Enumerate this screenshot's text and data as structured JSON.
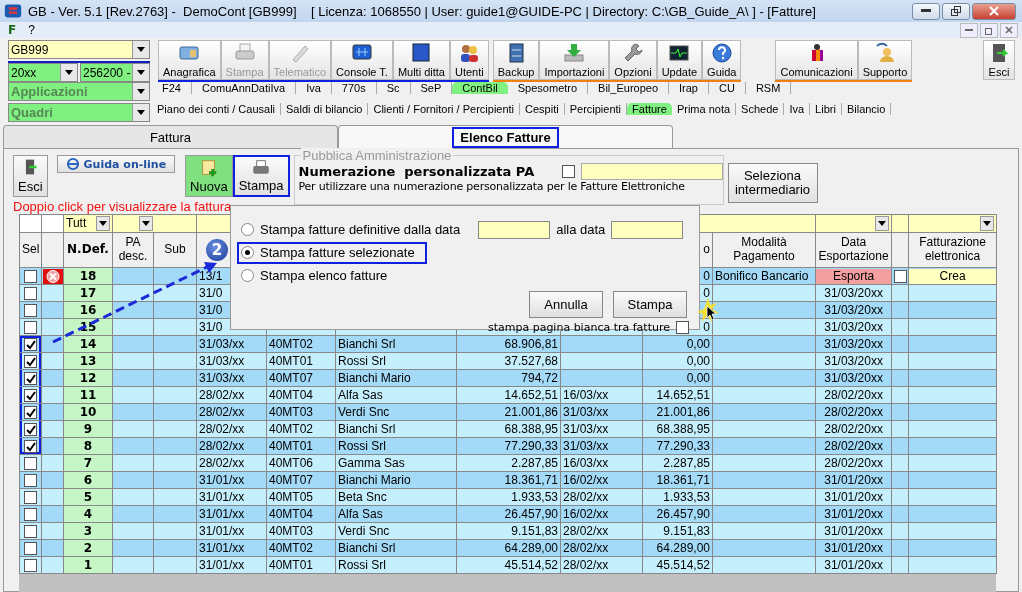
{
  "window": {
    "title": "GB - Ver. 5.1 [Rev.2763] -  DemoCont [GB999]    [ Licenza: 1068550 | User: guide1@GUIDE-PC | Directory: C:\\GB_Guide_A\\ ] - [Fatture]"
  },
  "menu": [
    "F",
    "?"
  ],
  "selectors": {
    "company": "GB999",
    "year": "20xx",
    "account": "256200 -",
    "applications": "Applicazioni",
    "panels": "Quadri"
  },
  "toolbar": [
    {
      "color": "#1020e0",
      "items": [
        {
          "label": "Anagrafica",
          "disabled": false
        },
        {
          "label": "Stampa",
          "disabled": true
        },
        {
          "label": "Telematico",
          "disabled": true
        },
        {
          "label": "Console T.",
          "disabled": false
        },
        {
          "label": "Multi ditta",
          "disabled": false
        },
        {
          "label": "Utenti",
          "disabled": false
        }
      ]
    },
    {
      "color": "#f08010",
      "items": [
        {
          "label": "Backup",
          "disabled": false
        },
        {
          "label": "Importazioni",
          "disabled": false
        },
        {
          "label": "Opzioni",
          "disabled": false
        },
        {
          "label": "Update",
          "disabled": false
        },
        {
          "label": "Guida",
          "disabled": false
        }
      ]
    },
    {
      "color": "#f08010",
      "items": [
        {
          "label": "Comunicazioni",
          "disabled": false
        },
        {
          "label": "Supporto",
          "disabled": false
        }
      ]
    },
    {
      "items": [
        {
          "label": "Esci",
          "disabled": false
        }
      ]
    }
  ],
  "app_tabs": [
    {
      "label": "F24",
      "selected": false
    },
    {
      "label": "ComuAnnDatiIva",
      "selected": false
    },
    {
      "label": "Iva",
      "selected": false
    },
    {
      "label": "770s",
      "selected": false
    },
    {
      "label": "Sc",
      "selected": false
    },
    {
      "label": "SeP",
      "selected": false
    },
    {
      "label": "ContBil",
      "selected": true
    },
    {
      "label": "Spesometro",
      "selected": false
    },
    {
      "label": "Bil_Europeo",
      "selected": false
    },
    {
      "label": "Irap",
      "selected": false
    },
    {
      "label": "CU",
      "selected": false
    },
    {
      "label": "RSM",
      "selected": false
    }
  ],
  "section_tabs": [
    {
      "label": "Piano dei conti / Causali",
      "selected": false
    },
    {
      "label": "Saldi di bilancio",
      "selected": false
    },
    {
      "label": "Clienti / Fornitori / Percipienti",
      "selected": false
    },
    {
      "label": "Cespiti",
      "selected": false
    },
    {
      "label": "Percipienti",
      "selected": false
    },
    {
      "label": "Fatture",
      "selected": true
    },
    {
      "label": "Prima nota",
      "selected": false
    },
    {
      "label": "Schede",
      "selected": false
    },
    {
      "label": "Iva",
      "selected": false
    },
    {
      "label": "Libri",
      "selected": false
    },
    {
      "label": "Bilancio",
      "selected": false
    }
  ],
  "view_tabs": [
    {
      "label": "Fattura",
      "selected": false,
      "highlighted": false
    },
    {
      "label": "Elenco Fatture",
      "selected": true,
      "highlighted": true
    }
  ],
  "actions": [
    {
      "kind": "exit",
      "label": "Esci",
      "highlighted": false
    },
    {
      "kind": "help",
      "label": "Guida on-line",
      "highlighted": false
    },
    {
      "kind": "new",
      "label": "Nuova",
      "highlighted": false
    },
    {
      "kind": "print",
      "label": "Stampa",
      "highlighted": true
    }
  ],
  "pa_group": {
    "legend": "Pubblica Amministrazione",
    "title": "Numerazione  personalizzata PA",
    "checked": false,
    "hint": "Per utilizzare una numerazione personalizzata per le Fatture Elettroniche",
    "button": "Seleziona intermediario"
  },
  "notice": "Doppio click per visualizzare la fattura",
  "table": {
    "filter": "Tutt",
    "headers": {
      "sel": "Sel",
      "number": "N.Def.",
      "pa_desc": "PA desc.",
      "sub": "Sub",
      "column_11": "o",
      "payment": "Modalità Pagamento",
      "export_date": "Data Esportazione",
      "e_invoicing": "Fatturazione elettronica"
    },
    "rows": [
      {
        "checked": false,
        "highlighted": false,
        "invalid": true,
        "number": "18",
        "date": "13/1",
        "amount2": "0",
        "payment": "Bonifico Bancario",
        "export_button": "Esporta",
        "export_checked": false,
        "create_button": "Crea"
      },
      {
        "checked": false,
        "highlighted": false,
        "invalid": false,
        "number": "17",
        "date": "31/0",
        "amount2": "0",
        "export_date": "31/03/20xx"
      },
      {
        "checked": false,
        "highlighted": false,
        "invalid": false,
        "number": "16",
        "date": "31/0",
        "export_date": "31/03/20xx"
      },
      {
        "checked": false,
        "highlighted": false,
        "invalid": false,
        "number": "15",
        "date": "31/0",
        "amount2": "0",
        "export_date": "31/03/20xx"
      },
      {
        "checked": true,
        "highlighted": true,
        "invalid": false,
        "number": "14",
        "date": "31/03/xx",
        "code": "40MT02",
        "client": "Bianchi Srl",
        "amount": "68.906,81",
        "amount2": "0,00",
        "export_date": "31/03/20xx"
      },
      {
        "checked": true,
        "highlighted": true,
        "invalid": false,
        "number": "13",
        "date": "31/03/xx",
        "code": "40MT01",
        "client": "Rossi Srl",
        "amount": "37.527,68",
        "amount2": "0,00",
        "export_date": "31/03/20xx"
      },
      {
        "checked": true,
        "highlighted": true,
        "invalid": false,
        "number": "12",
        "date": "31/03/xx",
        "code": "40MT07",
        "client": "Bianchi Mario",
        "amount": "794,72",
        "amount2": "0,00",
        "export_date": "31/03/20xx"
      },
      {
        "checked": true,
        "highlighted": true,
        "invalid": false,
        "number": "11",
        "date": "28/02/xx",
        "code": "40MT04",
        "client": "Alfa Sas",
        "amount": "14.652,51",
        "date2": "16/03/xx",
        "amount2": "14.652,51",
        "export_date": "28/02/20xx"
      },
      {
        "checked": true,
        "highlighted": true,
        "invalid": false,
        "number": "10",
        "date": "28/02/xx",
        "code": "40MT03",
        "client": "Verdi Snc",
        "amount": "21.001,86",
        "date2": "31/03/xx",
        "amount2": "21.001,86",
        "export_date": "28/02/20xx"
      },
      {
        "checked": true,
        "highlighted": true,
        "invalid": false,
        "number": "9",
        "date": "28/02/xx",
        "code": "40MT02",
        "client": "Bianchi Srl",
        "amount": "68.388,95",
        "date2": "31/03/xx",
        "amount2": "68.388,95",
        "export_date": "28/02/20xx"
      },
      {
        "checked": true,
        "highlighted": true,
        "invalid": false,
        "number": "8",
        "date": "28/02/xx",
        "code": "40MT01",
        "client": "Rossi Srl",
        "amount": "77.290,33",
        "date2": "31/03/xx",
        "amount2": "77.290,33",
        "export_date": "28/02/20xx"
      },
      {
        "checked": false,
        "highlighted": false,
        "invalid": false,
        "number": "7",
        "date": "28/02/xx",
        "code": "40MT06",
        "client": "Gamma Sas",
        "amount": "2.287,85",
        "date2": "16/03/xx",
        "amount2": "2.287,85",
        "export_date": "28/02/20xx"
      },
      {
        "checked": false,
        "highlighted": false,
        "invalid": false,
        "number": "6",
        "date": "31/01/xx",
        "code": "40MT07",
        "client": "Bianchi Mario",
        "amount": "18.361,71",
        "date2": "16/02/xx",
        "amount2": "18.361,71",
        "export_date": "31/01/20xx"
      },
      {
        "checked": false,
        "highlighted": false,
        "invalid": false,
        "number": "5",
        "date": "31/01/xx",
        "code": "40MT05",
        "client": "Beta Snc",
        "amount": "1.933,53",
        "date2": "28/02/xx",
        "amount2": "1.933,53",
        "export_date": "31/01/20xx"
      },
      {
        "checked": false,
        "highlighted": false,
        "invalid": false,
        "number": "4",
        "date": "31/01/xx",
        "code": "40MT04",
        "client": "Alfa Sas",
        "amount": "26.457,90",
        "date2": "16/02/xx",
        "amount2": "26.457,90",
        "export_date": "31/01/20xx"
      },
      {
        "checked": false,
        "highlighted": false,
        "invalid": false,
        "number": "3",
        "date": "31/01/xx",
        "code": "40MT03",
        "client": "Verdi Snc",
        "amount": "9.151,83",
        "date2": "28/02/xx",
        "amount2": "9.151,83",
        "export_date": "31/01/20xx"
      },
      {
        "checked": false,
        "highlighted": false,
        "invalid": false,
        "number": "2",
        "date": "31/01/xx",
        "code": "40MT02",
        "client": "Bianchi Srl",
        "amount": "64.289,00",
        "date2": "28/02/xx",
        "amount2": "64.289,00",
        "export_date": "31/01/20xx"
      },
      {
        "checked": false,
        "highlighted": false,
        "invalid": false,
        "number": "1",
        "date": "31/01/xx",
        "code": "40MT01",
        "client": "Rossi Srl",
        "amount": "45.514,52",
        "date2": "28/02/xx",
        "amount2": "45.514,52",
        "export_date": "31/01/20xx"
      }
    ]
  },
  "annotation": {
    "badge": "2"
  },
  "print_dialog": {
    "options": [
      {
        "kind": "date_range",
        "label": "Stampa fatture definitive dalla data",
        "selected": false,
        "highlighted": false
      },
      {
        "kind": "plain",
        "label": "Stampa fatture selezionate",
        "selected": true,
        "highlighted": true
      },
      {
        "kind": "plain",
        "label": "Stampa elenco fatture",
        "selected": false,
        "highlighted": false
      }
    ],
    "to_label": "alla data",
    "buttons": [
      "Annulla",
      "Stampa"
    ],
    "blank_page": {
      "label": "stampa pagina bianca tra fatture",
      "checked": false
    }
  }
}
